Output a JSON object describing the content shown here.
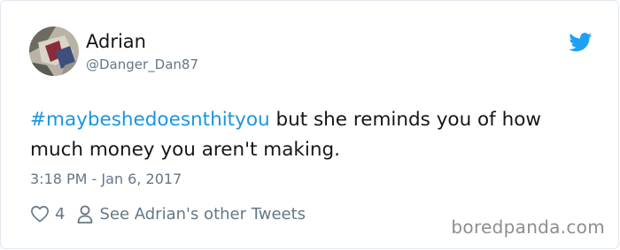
{
  "tweet": {
    "author_name": "Adrian",
    "author_handle": "@Danger_Dan87",
    "hashtag": "#maybeshedoesnthityou",
    "body_text": " but she reminds you of how much money you aren't making.",
    "timestamp": "3:18 PM - Jan 6, 2017",
    "like_count": "4",
    "other_tweets_link": "See Adrian's other Tweets",
    "brand_icon": "twitter-bird-icon",
    "accent_color": "#1b95e0"
  },
  "watermark": {
    "text": "boredpanda.com"
  }
}
